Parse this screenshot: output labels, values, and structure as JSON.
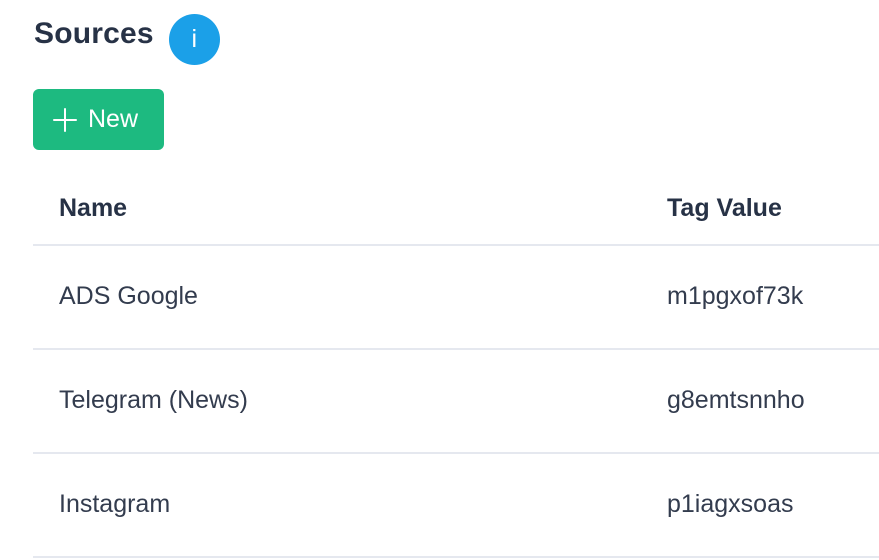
{
  "header": {
    "title": "Sources",
    "info_icon": "i"
  },
  "toolbar": {
    "new_label": "New"
  },
  "table": {
    "columns": [
      "Name",
      "Tag Value"
    ],
    "rows": [
      {
        "name": "ADS Google",
        "tag": "m1pgxof73k"
      },
      {
        "name": "Telegram (News)",
        "tag": "g8emtsnnho"
      },
      {
        "name": "Instagram",
        "tag": "p1iagxsoas"
      }
    ]
  },
  "colors": {
    "accent_green": "#1dba80",
    "info_blue": "#1ba0e8",
    "text_dark": "#273246",
    "divider": "#e5e8ef"
  },
  "icons": {
    "info": "info-icon",
    "add": "plus-icon"
  }
}
